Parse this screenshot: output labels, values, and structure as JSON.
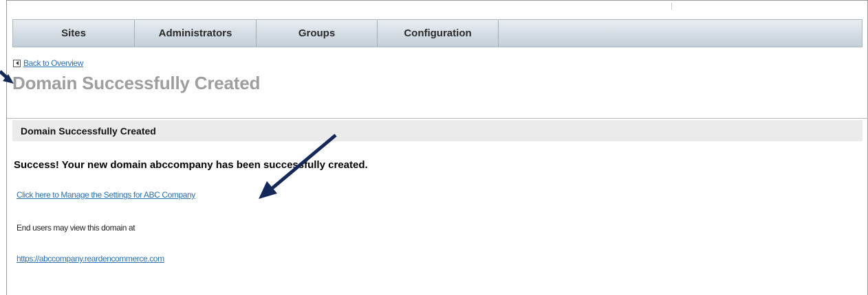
{
  "nav": {
    "tabs": [
      {
        "label": "Sites"
      },
      {
        "label": "Administrators"
      },
      {
        "label": "Groups"
      },
      {
        "label": "Configuration"
      }
    ]
  },
  "back_link": {
    "label": "Back to Overview",
    "icon": "back-arrow-icon"
  },
  "page": {
    "title": "Domain Successfully Created"
  },
  "section": {
    "header": "Domain Successfully Created"
  },
  "content": {
    "success_message": "Success! Your new domain abccompany has been successfully created.",
    "manage_link": "Click here to Manage the Settings for ABC Company",
    "end_users_text": "End users may view this domain at",
    "domain_url": "https://abccompany.reardencommerce.com"
  },
  "colors": {
    "accent_link": "#2a6fb5",
    "title_gray": "#9e9e9e",
    "annotation_arrow": "#14295a"
  }
}
